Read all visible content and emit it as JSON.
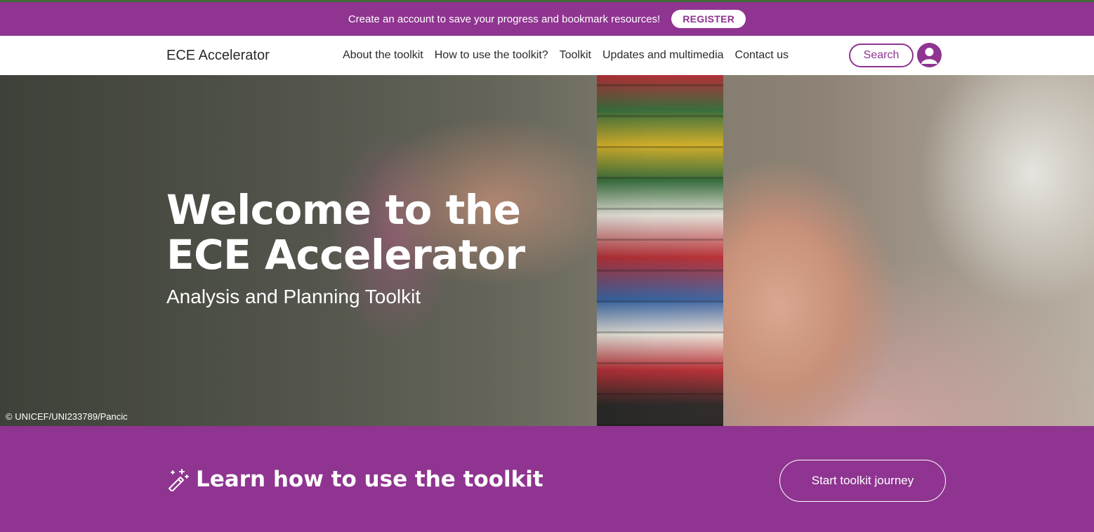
{
  "announcement": {
    "text": "Create an account to save your progress and bookmark resources!",
    "register_label": "REGISTER"
  },
  "nav": {
    "brand": "ECE Accelerator",
    "links": [
      {
        "label": "About the toolkit"
      },
      {
        "label": "How to use the toolkit?"
      },
      {
        "label": "Toolkit"
      },
      {
        "label": "Updates and multimedia"
      },
      {
        "label": "Contact us"
      }
    ],
    "search_label": "Search",
    "avatar_icon": "user-icon"
  },
  "hero": {
    "title_line1": "Welcome to the",
    "title_line2": "ECE Accelerator",
    "subtitle": "Analysis and Planning Toolkit",
    "credit": "© UNICEF/UNI233789/Pancic"
  },
  "cta": {
    "icon": "magic-wand-icon",
    "heading": "Learn how to use the toolkit",
    "button_label": "Start toolkit journey"
  },
  "colors": {
    "brand_purple": "#8f3490",
    "white": "#ffffff"
  }
}
